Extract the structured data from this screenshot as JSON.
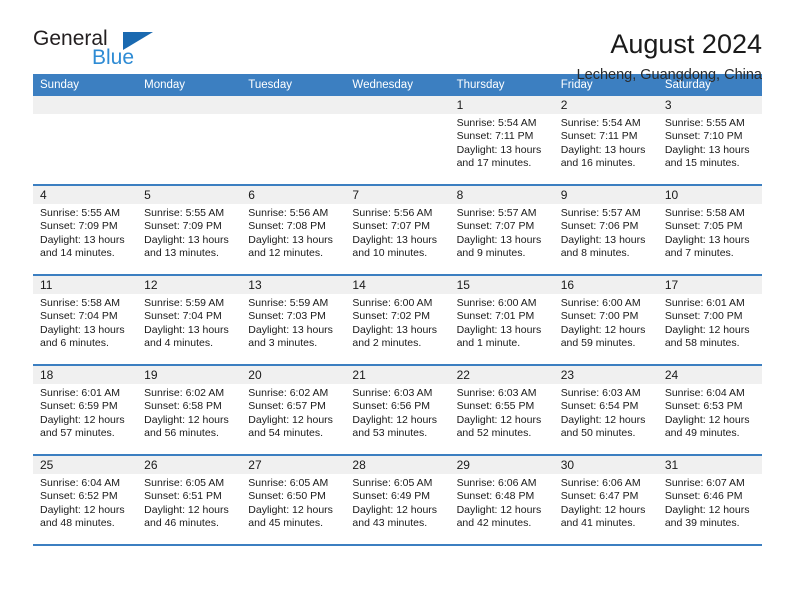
{
  "brand": {
    "name_part1": "General",
    "name_part2": "Blue",
    "triangle_color": "#1a69b0",
    "blue_color": "#2e8bd4"
  },
  "header": {
    "title": "August 2024",
    "subtitle": "Lecheng, Guangdong, China"
  },
  "theme": {
    "header_blue": "#3c7fc1",
    "daynum_band": "#f0f0f0",
    "text": "#1a1a1a"
  },
  "weekdays": [
    "Sunday",
    "Monday",
    "Tuesday",
    "Wednesday",
    "Thursday",
    "Friday",
    "Saturday"
  ],
  "weeks": [
    [
      {
        "day": "",
        "sunrise": "",
        "sunset": "",
        "daylight_line1": "",
        "daylight_line2": ""
      },
      {
        "day": "",
        "sunrise": "",
        "sunset": "",
        "daylight_line1": "",
        "daylight_line2": ""
      },
      {
        "day": "",
        "sunrise": "",
        "sunset": "",
        "daylight_line1": "",
        "daylight_line2": ""
      },
      {
        "day": "",
        "sunrise": "",
        "sunset": "",
        "daylight_line1": "",
        "daylight_line2": ""
      },
      {
        "day": "1",
        "sunrise": "Sunrise: 5:54 AM",
        "sunset": "Sunset: 7:11 PM",
        "daylight_line1": "Daylight: 13 hours",
        "daylight_line2": "and 17 minutes."
      },
      {
        "day": "2",
        "sunrise": "Sunrise: 5:54 AM",
        "sunset": "Sunset: 7:11 PM",
        "daylight_line1": "Daylight: 13 hours",
        "daylight_line2": "and 16 minutes."
      },
      {
        "day": "3",
        "sunrise": "Sunrise: 5:55 AM",
        "sunset": "Sunset: 7:10 PM",
        "daylight_line1": "Daylight: 13 hours",
        "daylight_line2": "and 15 minutes."
      }
    ],
    [
      {
        "day": "4",
        "sunrise": "Sunrise: 5:55 AM",
        "sunset": "Sunset: 7:09 PM",
        "daylight_line1": "Daylight: 13 hours",
        "daylight_line2": "and 14 minutes."
      },
      {
        "day": "5",
        "sunrise": "Sunrise: 5:55 AM",
        "sunset": "Sunset: 7:09 PM",
        "daylight_line1": "Daylight: 13 hours",
        "daylight_line2": "and 13 minutes."
      },
      {
        "day": "6",
        "sunrise": "Sunrise: 5:56 AM",
        "sunset": "Sunset: 7:08 PM",
        "daylight_line1": "Daylight: 13 hours",
        "daylight_line2": "and 12 minutes."
      },
      {
        "day": "7",
        "sunrise": "Sunrise: 5:56 AM",
        "sunset": "Sunset: 7:07 PM",
        "daylight_line1": "Daylight: 13 hours",
        "daylight_line2": "and 10 minutes."
      },
      {
        "day": "8",
        "sunrise": "Sunrise: 5:57 AM",
        "sunset": "Sunset: 7:07 PM",
        "daylight_line1": "Daylight: 13 hours",
        "daylight_line2": "and 9 minutes."
      },
      {
        "day": "9",
        "sunrise": "Sunrise: 5:57 AM",
        "sunset": "Sunset: 7:06 PM",
        "daylight_line1": "Daylight: 13 hours",
        "daylight_line2": "and 8 minutes."
      },
      {
        "day": "10",
        "sunrise": "Sunrise: 5:58 AM",
        "sunset": "Sunset: 7:05 PM",
        "daylight_line1": "Daylight: 13 hours",
        "daylight_line2": "and 7 minutes."
      }
    ],
    [
      {
        "day": "11",
        "sunrise": "Sunrise: 5:58 AM",
        "sunset": "Sunset: 7:04 PM",
        "daylight_line1": "Daylight: 13 hours",
        "daylight_line2": "and 6 minutes."
      },
      {
        "day": "12",
        "sunrise": "Sunrise: 5:59 AM",
        "sunset": "Sunset: 7:04 PM",
        "daylight_line1": "Daylight: 13 hours",
        "daylight_line2": "and 4 minutes."
      },
      {
        "day": "13",
        "sunrise": "Sunrise: 5:59 AM",
        "sunset": "Sunset: 7:03 PM",
        "daylight_line1": "Daylight: 13 hours",
        "daylight_line2": "and 3 minutes."
      },
      {
        "day": "14",
        "sunrise": "Sunrise: 6:00 AM",
        "sunset": "Sunset: 7:02 PM",
        "daylight_line1": "Daylight: 13 hours",
        "daylight_line2": "and 2 minutes."
      },
      {
        "day": "15",
        "sunrise": "Sunrise: 6:00 AM",
        "sunset": "Sunset: 7:01 PM",
        "daylight_line1": "Daylight: 13 hours",
        "daylight_line2": "and 1 minute."
      },
      {
        "day": "16",
        "sunrise": "Sunrise: 6:00 AM",
        "sunset": "Sunset: 7:00 PM",
        "daylight_line1": "Daylight: 12 hours",
        "daylight_line2": "and 59 minutes."
      },
      {
        "day": "17",
        "sunrise": "Sunrise: 6:01 AM",
        "sunset": "Sunset: 7:00 PM",
        "daylight_line1": "Daylight: 12 hours",
        "daylight_line2": "and 58 minutes."
      }
    ],
    [
      {
        "day": "18",
        "sunrise": "Sunrise: 6:01 AM",
        "sunset": "Sunset: 6:59 PM",
        "daylight_line1": "Daylight: 12 hours",
        "daylight_line2": "and 57 minutes."
      },
      {
        "day": "19",
        "sunrise": "Sunrise: 6:02 AM",
        "sunset": "Sunset: 6:58 PM",
        "daylight_line1": "Daylight: 12 hours",
        "daylight_line2": "and 56 minutes."
      },
      {
        "day": "20",
        "sunrise": "Sunrise: 6:02 AM",
        "sunset": "Sunset: 6:57 PM",
        "daylight_line1": "Daylight: 12 hours",
        "daylight_line2": "and 54 minutes."
      },
      {
        "day": "21",
        "sunrise": "Sunrise: 6:03 AM",
        "sunset": "Sunset: 6:56 PM",
        "daylight_line1": "Daylight: 12 hours",
        "daylight_line2": "and 53 minutes."
      },
      {
        "day": "22",
        "sunrise": "Sunrise: 6:03 AM",
        "sunset": "Sunset: 6:55 PM",
        "daylight_line1": "Daylight: 12 hours",
        "daylight_line2": "and 52 minutes."
      },
      {
        "day": "23",
        "sunrise": "Sunrise: 6:03 AM",
        "sunset": "Sunset: 6:54 PM",
        "daylight_line1": "Daylight: 12 hours",
        "daylight_line2": "and 50 minutes."
      },
      {
        "day": "24",
        "sunrise": "Sunrise: 6:04 AM",
        "sunset": "Sunset: 6:53 PM",
        "daylight_line1": "Daylight: 12 hours",
        "daylight_line2": "and 49 minutes."
      }
    ],
    [
      {
        "day": "25",
        "sunrise": "Sunrise: 6:04 AM",
        "sunset": "Sunset: 6:52 PM",
        "daylight_line1": "Daylight: 12 hours",
        "daylight_line2": "and 48 minutes."
      },
      {
        "day": "26",
        "sunrise": "Sunrise: 6:05 AM",
        "sunset": "Sunset: 6:51 PM",
        "daylight_line1": "Daylight: 12 hours",
        "daylight_line2": "and 46 minutes."
      },
      {
        "day": "27",
        "sunrise": "Sunrise: 6:05 AM",
        "sunset": "Sunset: 6:50 PM",
        "daylight_line1": "Daylight: 12 hours",
        "daylight_line2": "and 45 minutes."
      },
      {
        "day": "28",
        "sunrise": "Sunrise: 6:05 AM",
        "sunset": "Sunset: 6:49 PM",
        "daylight_line1": "Daylight: 12 hours",
        "daylight_line2": "and 43 minutes."
      },
      {
        "day": "29",
        "sunrise": "Sunrise: 6:06 AM",
        "sunset": "Sunset: 6:48 PM",
        "daylight_line1": "Daylight: 12 hours",
        "daylight_line2": "and 42 minutes."
      },
      {
        "day": "30",
        "sunrise": "Sunrise: 6:06 AM",
        "sunset": "Sunset: 6:47 PM",
        "daylight_line1": "Daylight: 12 hours",
        "daylight_line2": "and 41 minutes."
      },
      {
        "day": "31",
        "sunrise": "Sunrise: 6:07 AM",
        "sunset": "Sunset: 6:46 PM",
        "daylight_line1": "Daylight: 12 hours",
        "daylight_line2": "and 39 minutes."
      }
    ]
  ]
}
